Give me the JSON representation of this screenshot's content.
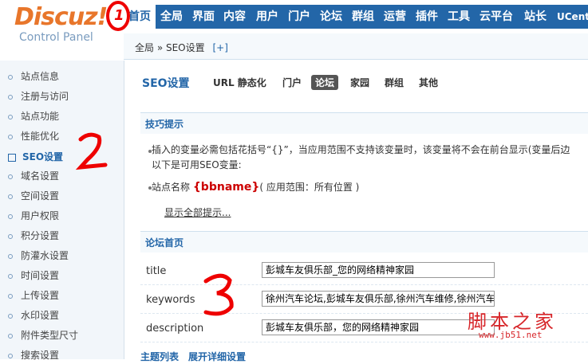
{
  "logo": {
    "brand": "Discuz!",
    "sub": "Control Panel"
  },
  "nav": {
    "items": [
      {
        "label": "首页",
        "active": true
      },
      {
        "label": "全局"
      },
      {
        "label": "界面"
      },
      {
        "label": "内容"
      },
      {
        "label": "用户"
      },
      {
        "label": "门户"
      },
      {
        "label": "论坛"
      },
      {
        "label": "群组"
      },
      {
        "label": "运营"
      },
      {
        "label": "插件"
      },
      {
        "label": "工具"
      },
      {
        "label": "云平台"
      },
      {
        "label": "站长"
      },
      {
        "label": "UCent"
      }
    ]
  },
  "breadcrumb": {
    "text": "全局 » SEO设置",
    "add": "[+]"
  },
  "sidebar": {
    "items": [
      {
        "label": "站点信息"
      },
      {
        "label": "注册与访问"
      },
      {
        "label": "站点功能"
      },
      {
        "label": "性能优化"
      },
      {
        "label": "SEO设置",
        "active": true
      },
      {
        "label": "域名设置"
      },
      {
        "label": "空间设置"
      },
      {
        "label": "用户权限"
      },
      {
        "label": "积分设置"
      },
      {
        "label": "防灌水设置"
      },
      {
        "label": "时间设置"
      },
      {
        "label": "上传设置"
      },
      {
        "label": "水印设置"
      },
      {
        "label": "附件类型尺寸"
      },
      {
        "label": "搜索设置"
      }
    ]
  },
  "main": {
    "title": "SEO设置",
    "tabs": [
      {
        "label": "URL 静态化"
      },
      {
        "label": "门户"
      },
      {
        "label": "论坛",
        "active": true
      },
      {
        "label": "家园"
      },
      {
        "label": "群组"
      },
      {
        "label": "其他"
      }
    ],
    "tips_title": "技巧提示",
    "tip1_line1": "插入的变量必需包括花括号“{}”，当应用范围不支持该变量时，该变量将不会在前台显示(变量后边",
    "tip1_line2": "以下是可用SEO变量:",
    "tip2_prefix": "站点名称",
    "tip2_var": "{bbname}",
    "tip2_suffix": "( 应用范围：所有位置 )",
    "show_all": "显示全部提示...",
    "forum_home_title": "论坛首页",
    "fields": [
      {
        "label": "title",
        "value": "彭城车友俱乐部_您的网络精神家园"
      },
      {
        "label": "keywords",
        "value": "徐州汽车论坛,彭城车友俱乐部,徐州汽车维修,徐州汽车"
      },
      {
        "label": "description",
        "value": "彭城车友俱乐部，您的网络精神家园"
      }
    ],
    "footer_heading": "主题列表　展开详细设置"
  },
  "annotations": {
    "one": "1",
    "two": "2",
    "three": "3"
  },
  "watermark": {
    "text": "脚本之家",
    "url": "www.jb51.net"
  },
  "colors": {
    "nav_bg": "#2366a8",
    "annotation": "#e00000",
    "logo": "#e8762b"
  }
}
